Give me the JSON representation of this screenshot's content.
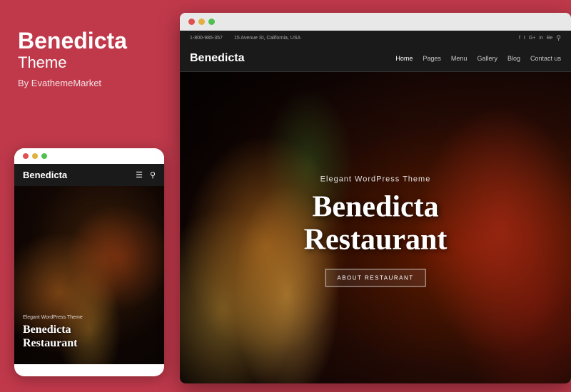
{
  "left": {
    "title_line1": "Benedicta",
    "title_line2": "Theme",
    "by_label": "By EvathemeMarket",
    "bg_color": "#c0394b"
  },
  "mobile": {
    "dots": [
      "#e05050",
      "#e0b040",
      "#50c050"
    ],
    "nav_logo": "Benedicta",
    "tagline": "Elegant WordPress Theme",
    "headline_line1": "Benedicta",
    "headline_line2": "Restaurant"
  },
  "desktop": {
    "chrome_dots": [
      "#e05050",
      "#e0b040",
      "#50c050"
    ],
    "address_bar": {
      "phone": "1-800-985-357",
      "address": "15 Avenue St, California, USA"
    },
    "social_icons": [
      "f",
      "t",
      "G+",
      "in",
      "Be"
    ],
    "nav": {
      "logo": "Benedicta",
      "links": [
        "Home",
        "Pages",
        "Menu",
        "Gallery",
        "Blog",
        "Contact us"
      ],
      "active": "Home"
    },
    "hero": {
      "tagline": "Elegant WordPress Theme",
      "headline_line1": "Benedicta",
      "headline_line2": "Restaurant",
      "button_label": "ABOUT RESTAURANT"
    }
  }
}
